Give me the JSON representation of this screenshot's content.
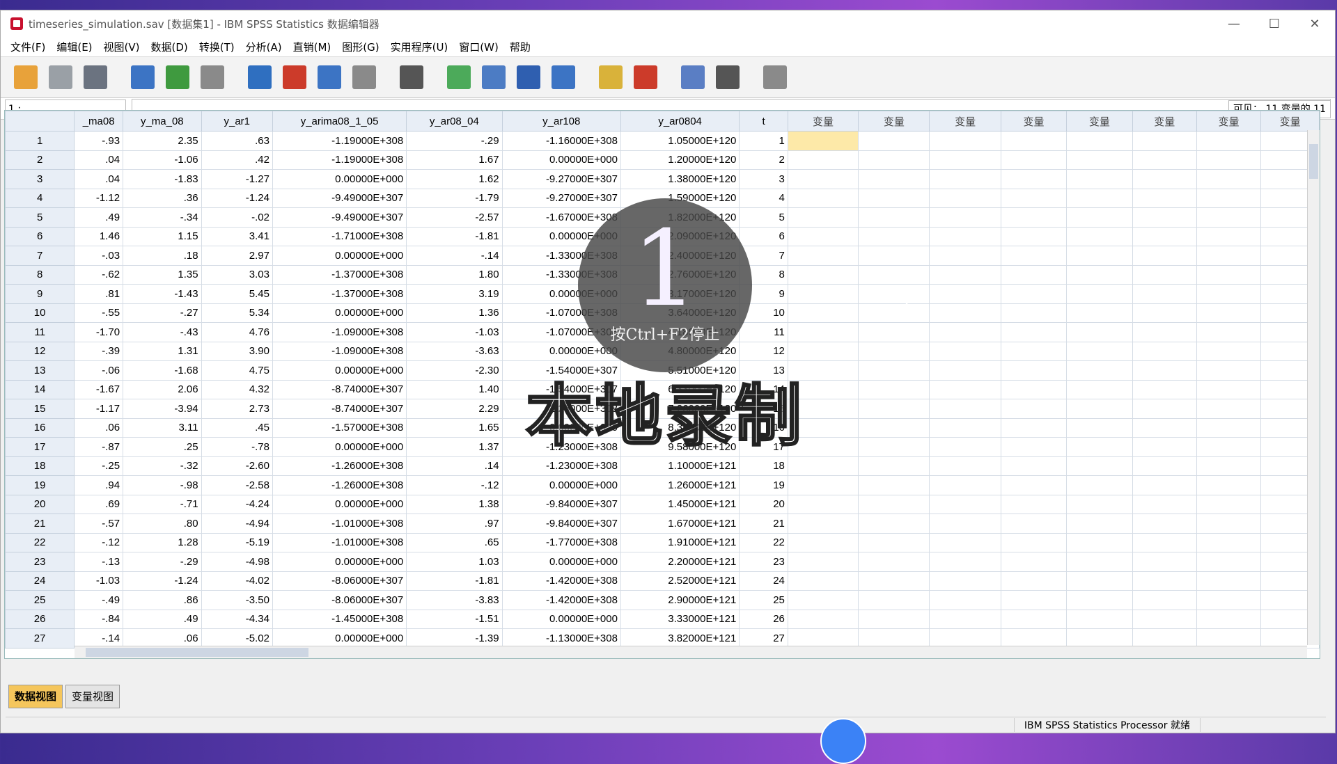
{
  "window": {
    "title": "timeseries_simulation.sav [数据集1] - IBM SPSS Statistics 数据编辑器",
    "controls": [
      "—",
      "☐",
      "✕"
    ]
  },
  "menu": [
    "文件(F)",
    "编辑(E)",
    "视图(V)",
    "数据(D)",
    "转换(T)",
    "分析(A)",
    "直销(M)",
    "图形(G)",
    "实用程序(U)",
    "窗口(W)",
    "帮助"
  ],
  "toolbar": {
    "icons": [
      {
        "name": "open-icon",
        "color": "#e8a23a"
      },
      {
        "name": "save-icon",
        "color": "#9aa0a6"
      },
      {
        "name": "print-icon",
        "color": "#6b7380"
      },
      {
        "name": "recall-dialog-icon",
        "color": "#3c74c4"
      },
      {
        "name": "undo-icon",
        "color": "#3f9a3f"
      },
      {
        "name": "redo-icon",
        "color": "#8a8a8a"
      },
      {
        "name": "goto-case-icon",
        "color": "#2f6fc0"
      },
      {
        "name": "goto-variable-icon",
        "color": "#cc3b2a"
      },
      {
        "name": "variables-icon",
        "color": "#3c74c4"
      },
      {
        "name": "run-descriptive-icon",
        "color": "#8a8a8a"
      },
      {
        "name": "find-icon",
        "color": "#555555"
      },
      {
        "name": "insert-cases-icon",
        "color": "#4caa5a"
      },
      {
        "name": "insert-variable-icon",
        "color": "#4c7cc4"
      },
      {
        "name": "split-file-icon",
        "color": "#2f5fb0"
      },
      {
        "name": "weight-cases-icon",
        "color": "#3c74c4"
      },
      {
        "name": "select-cases-icon",
        "color": "#d9b23a"
      },
      {
        "name": "value-labels-icon",
        "color": "#cc3b2a"
      },
      {
        "name": "use-sets-icon",
        "color": "#5a7ec4"
      },
      {
        "name": "show-all-icon",
        "color": "#555555"
      },
      {
        "name": "spelling-icon",
        "color": "#8a8a8a"
      }
    ]
  },
  "cellbar": {
    "ref": "1 :",
    "value": "",
    "visible": "可见： 11 变量的 11"
  },
  "grid": {
    "columns": [
      "_ma08",
      "y_ma_08",
      "y_ar1",
      "y_arima08_1_05",
      "y_ar08_04",
      "y_ar108",
      "y_ar0804",
      "t",
      "变量",
      "变量",
      "变量",
      "变量",
      "变量",
      "变量",
      "变量",
      "变量"
    ],
    "rows": [
      [
        "1",
        "-.93",
        "2.35",
        ".63",
        "-1.19000E+308",
        "-.29",
        "-1.16000E+308",
        "1.05000E+120",
        "1"
      ],
      [
        "2",
        ".04",
        "-1.06",
        ".42",
        "-1.19000E+308",
        "1.67",
        "0.00000E+000",
        "1.20000E+120",
        "2"
      ],
      [
        "3",
        ".04",
        "-1.83",
        "-1.27",
        "0.00000E+000",
        "1.62",
        "-9.27000E+307",
        "1.38000E+120",
        "3"
      ],
      [
        "4",
        "-1.12",
        ".36",
        "-1.24",
        "-9.49000E+307",
        "-1.79",
        "-9.27000E+307",
        "1.59000E+120",
        "4"
      ],
      [
        "5",
        ".49",
        "-.34",
        "-.02",
        "-9.49000E+307",
        "-2.57",
        "-1.67000E+308",
        "1.82000E+120",
        "5"
      ],
      [
        "6",
        "1.46",
        "1.15",
        "3.41",
        "-1.71000E+308",
        "-1.81",
        "0.00000E+000",
        "2.09000E+120",
        "6"
      ],
      [
        "7",
        "-.03",
        ".18",
        "2.97",
        "0.00000E+000",
        "-.14",
        "-1.33000E+308",
        "2.40000E+120",
        "7"
      ],
      [
        "8",
        "-.62",
        "1.35",
        "3.03",
        "-1.37000E+308",
        "1.80",
        "-1.33000E+308",
        "2.76000E+120",
        "8"
      ],
      [
        "9",
        ".81",
        "-1.43",
        "5.45",
        "-1.37000E+308",
        "3.19",
        "0.00000E+000",
        "3.17000E+120",
        "9"
      ],
      [
        "10",
        "-.55",
        "-.27",
        "5.34",
        "0.00000E+000",
        "1.36",
        "-1.07000E+308",
        "3.64000E+120",
        "10"
      ],
      [
        "11",
        "-1.70",
        "-.43",
        "4.76",
        "-1.09000E+308",
        "-1.03",
        "-1.07000E+308",
        "4.18000E+120",
        "11"
      ],
      [
        "12",
        "-.39",
        "1.31",
        "3.90",
        "-1.09000E+308",
        "-3.63",
        "0.00000E+000",
        "4.80000E+120",
        "12"
      ],
      [
        "13",
        "-.06",
        "-1.68",
        "4.75",
        "0.00000E+000",
        "-2.30",
        "-1.54000E+307",
        "5.51000E+120",
        "13"
      ],
      [
        "14",
        "-1.67",
        "2.06",
        "4.32",
        "-8.74000E+307",
        "1.40",
        "-1.54000E+307",
        "6.33000E+120",
        "14"
      ],
      [
        "15",
        "-1.17",
        "-3.94",
        "2.73",
        "-8.74000E+307",
        "2.29",
        "-1.26000E+308",
        "7.26000E+120",
        "15"
      ],
      [
        "16",
        ".06",
        "3.11",
        ".45",
        "-1.57000E+308",
        "1.65",
        "0.00000E+000",
        "8.34000E+120",
        "16"
      ],
      [
        "17",
        "-.87",
        ".25",
        "-.78",
        "0.00000E+000",
        "1.37",
        "-1.23000E+308",
        "9.58000E+120",
        "17"
      ],
      [
        "18",
        "-.25",
        "-.32",
        "-2.60",
        "-1.26000E+308",
        ".14",
        "-1.23000E+308",
        "1.10000E+121",
        "18"
      ],
      [
        "19",
        ".94",
        "-.98",
        "-2.58",
        "-1.26000E+308",
        "-.12",
        "0.00000E+000",
        "1.26000E+121",
        "19"
      ],
      [
        "20",
        ".69",
        "-.71",
        "-4.24",
        "0.00000E+000",
        "1.38",
        "-9.84000E+307",
        "1.45000E+121",
        "20"
      ],
      [
        "21",
        "-.57",
        ".80",
        "-4.94",
        "-1.01000E+308",
        ".97",
        "-9.84000E+307",
        "1.67000E+121",
        "21"
      ],
      [
        "22",
        "-.12",
        "1.28",
        "-5.19",
        "-1.01000E+308",
        ".65",
        "-1.77000E+308",
        "1.91000E+121",
        "22"
      ],
      [
        "23",
        "-.13",
        "-.29",
        "-4.98",
        "0.00000E+000",
        "1.03",
        "0.00000E+000",
        "2.20000E+121",
        "23"
      ],
      [
        "24",
        "-1.03",
        "-1.24",
        "-4.02",
        "-8.06000E+307",
        "-1.81",
        "-1.42000E+308",
        "2.52000E+121",
        "24"
      ],
      [
        "25",
        "-.49",
        ".86",
        "-3.50",
        "-8.06000E+307",
        "-3.83",
        "-1.42000E+308",
        "2.90000E+121",
        "25"
      ],
      [
        "26",
        "-.84",
        ".49",
        "-4.34",
        "-1.45000E+308",
        "-1.51",
        "0.00000E+000",
        "3.33000E+121",
        "26"
      ],
      [
        "27",
        "-.14",
        ".06",
        "-5.02",
        "0.00000E+000",
        "-1.39",
        "-1.13000E+308",
        "3.82000E+121",
        "27"
      ]
    ]
  },
  "tabs": [
    "数据视图",
    "变量视图"
  ],
  "status": "IBM SPSS Statistics Processor 就绪",
  "overlay": {
    "number": "1",
    "hint": "按Ctrl+F2停止",
    "big": "本地录制"
  }
}
